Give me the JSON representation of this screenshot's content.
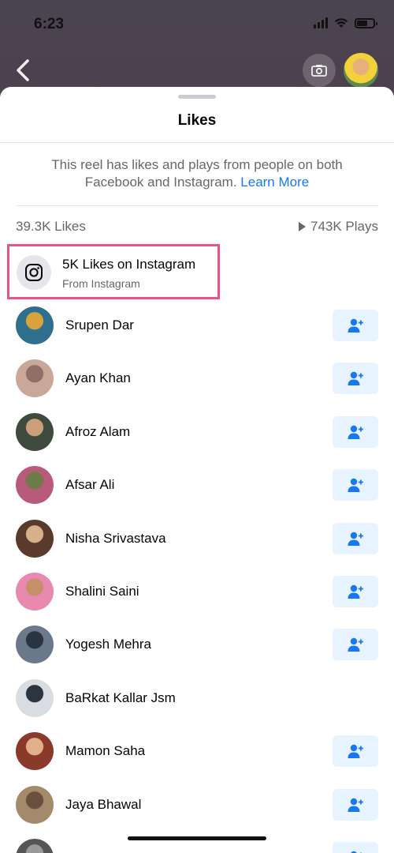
{
  "status_bar": {
    "time": "6:23"
  },
  "sheet": {
    "title": "Likes",
    "info_text": "This reel has likes and plays from people on both Facebook and Instagram.",
    "learn_more": "Learn More",
    "likes_count": "39.3K Likes",
    "plays_count": "743K Plays"
  },
  "instagram_row": {
    "title": "5K Likes on Instagram",
    "subtitle": "From Instagram",
    "icon": "instagram-icon",
    "highlight_color": "#e9538a"
  },
  "people": [
    {
      "name": "Srupen Dar",
      "has_add_button": true,
      "avatar_colors": [
        "#2e6f8e",
        "#d9a23a"
      ]
    },
    {
      "name": "Ayan Khan",
      "has_add_button": true,
      "avatar_colors": [
        "#c9a89a",
        "#8f6f66"
      ]
    },
    {
      "name": "Afroz Alam",
      "has_add_button": true,
      "avatar_colors": [
        "#3d4a3c",
        "#c9a07a"
      ]
    },
    {
      "name": "Afsar Ali",
      "has_add_button": true,
      "avatar_colors": [
        "#b85a7a",
        "#6e7a4a"
      ]
    },
    {
      "name": "Nisha Srivastava",
      "has_add_button": true,
      "avatar_colors": [
        "#5a3a2a",
        "#d8b08a"
      ]
    },
    {
      "name": "Shalini Saini",
      "has_add_button": true,
      "avatar_colors": [
        "#e88ab0",
        "#c58f6a"
      ]
    },
    {
      "name": "Yogesh Mehra",
      "has_add_button": true,
      "avatar_colors": [
        "#6a7a8a",
        "#2a3440"
      ]
    },
    {
      "name": "BaRkat Kallar Jsm",
      "has_add_button": false,
      "avatar_colors": [
        "#d9dde2",
        "#2c3440"
      ]
    },
    {
      "name": "Mamon Saha",
      "has_add_button": true,
      "avatar_colors": [
        "#8a3a2a",
        "#e0b08a"
      ]
    },
    {
      "name": "Jaya Bhawal",
      "has_add_button": true,
      "avatar_colors": [
        "#a48a6a",
        "#6a5040"
      ]
    },
    {
      "name": "",
      "has_add_button": true,
      "avatar_colors": [
        "#555",
        "#999"
      ]
    }
  ],
  "colors": {
    "accent": "#1877f2",
    "add_button_bg": "#e7f3ff",
    "secondary_text": "#65676b"
  }
}
